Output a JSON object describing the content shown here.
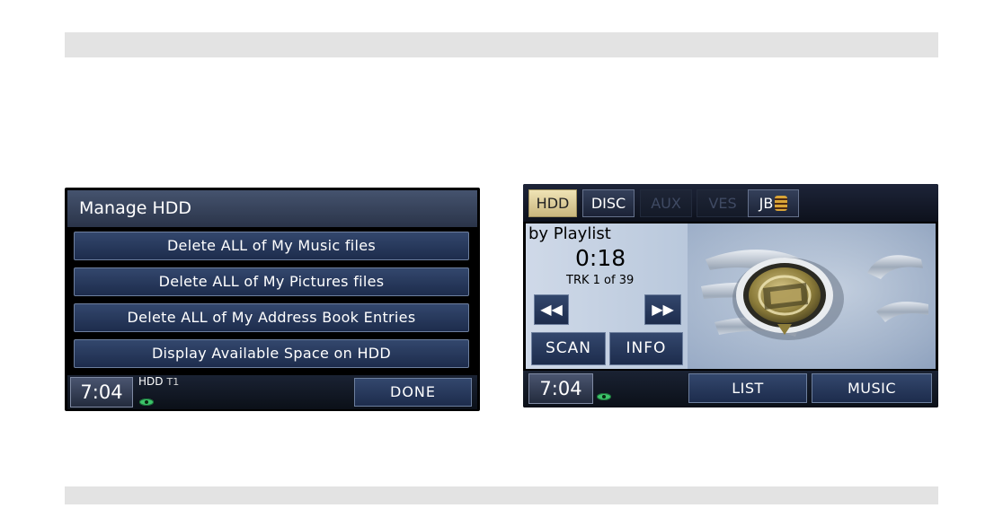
{
  "left_screen": {
    "title": "Manage HDD",
    "menu_items": [
      "Delete ALL of My Music files",
      "Delete ALL of My Pictures files",
      "Delete ALL of My Address Book Entries",
      "Display Available Space on HDD"
    ],
    "clock": "7:04",
    "source_label": "HDD",
    "track_indicator": "T1",
    "done_label": "DONE"
  },
  "right_screen": {
    "tabs": [
      {
        "label": "HDD",
        "state": "active"
      },
      {
        "label": "DISC",
        "state": "normal"
      },
      {
        "label": "AUX",
        "state": "disabled"
      },
      {
        "label": "VES",
        "state": "disabled"
      },
      {
        "label": "JB",
        "state": "normal",
        "icon": "jukebox-icon"
      }
    ],
    "mode": "by Playlist",
    "elapsed_time": "0:18",
    "track_info": "TRK 1 of 39",
    "rewind_icon": "rewind-icon",
    "fast_forward_icon": "fast-forward-icon",
    "scan_label": "SCAN",
    "info_label": "INFO",
    "clock": "7:04",
    "list_label": "LIST",
    "music_label": "MUSIC"
  },
  "colors": {
    "button_blue": "#2a3c60",
    "active_tab": "#e6d8a8",
    "disc_icon_green": "#3cc46a",
    "panel_background": "#c4d1e3"
  }
}
